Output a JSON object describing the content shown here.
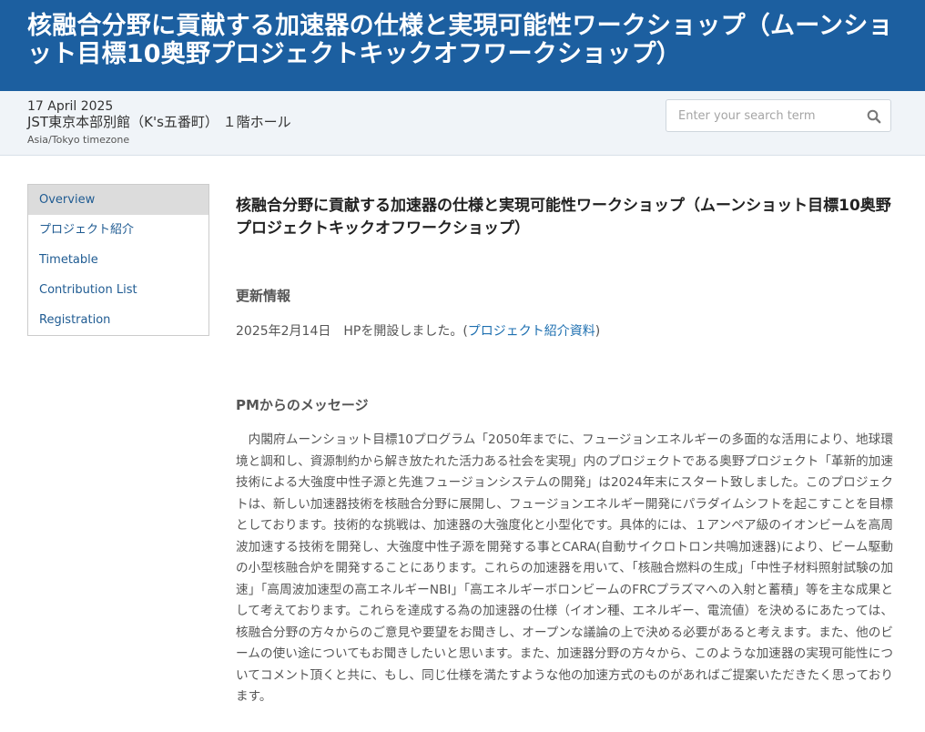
{
  "banner": {
    "title": "核融合分野に貢献する加速器の仕様と実現可能性ワークショップ（ムーンショット目標10奥野プロジェクトキックオフワークショップ）"
  },
  "event_info": {
    "date": "17 April 2025",
    "venue": "JST東京本部別館（K's五番町） １階ホール",
    "timezone": "Asia/Tokyo timezone"
  },
  "search": {
    "placeholder": "Enter your search term",
    "icon": "search-icon"
  },
  "sidebar": {
    "items": [
      {
        "label": "Overview",
        "active": true
      },
      {
        "label": "プロジェクト紹介",
        "active": false
      },
      {
        "label": "Timetable",
        "active": false
      },
      {
        "label": "Contribution List",
        "active": false
      },
      {
        "label": "Registration",
        "active": false
      }
    ]
  },
  "main": {
    "title": "核融合分野に貢献する加速器の仕様と実現可能性ワークショップ（ムーンショット目標10奥野プロジェクトキックオフワークショップ）",
    "updates_heading": "更新情報",
    "update_text": "2025年2月14日　HPを開設しました。(",
    "update_link": "プロジェクト紹介資料",
    "update_close": ")",
    "pm_heading": "PMからのメッセージ",
    "pm_body": "内閣府ムーンショット目標10プログラム「2050年までに、フュージョンエネルギーの多面的な活用により、地球環境と調和し、資源制約から解き放たれた活力ある社会を実現」内のプロジェクトである奥野プロジェクト「革新的加速技術による大強度中性子源と先進フュージョンシステムの開発」は2024年末にスタート致しました。このプロジェクトは、新しい加速器技術を核融合分野に展開し、フュージョンエネルギー開発にパラダイムシフトを起こすことを目標としております。技術的な挑戦は、加速器の大強度化と小型化です。具体的には、１アンペア級のイオンビームを高周波加速する技術を開発し、大強度中性子源を開発する事とCARA(自動サイクロトロン共鳴加速器)により、ビーム駆動の小型核融合炉を開発することにあります。これらの加速器を用いて、「核融合燃料の生成」「中性子材料照射試験の加速」「高周波加速型の高エネルギーNBI」「高エネルギーボロンビームのFRCプラズマへの入射と蓄積」等を主な成果として考えております。これらを達成する為の加速器の仕様（イオン種、エネルギー、電流値）を決めるにあたっては、核融合分野の方々からのご意見や要望をお聞きし、オープンな議論の上で決める必要があると考えます。また、他のビームの使い途についてもお聞きしたいと思います。また、加速器分野の方々から、このような加速器の実現可能性についてコメント頂くと共に、もし、同じ仕様を満たすような他の加速方式のものがあればご提案いただきたく思っております。"
  }
}
